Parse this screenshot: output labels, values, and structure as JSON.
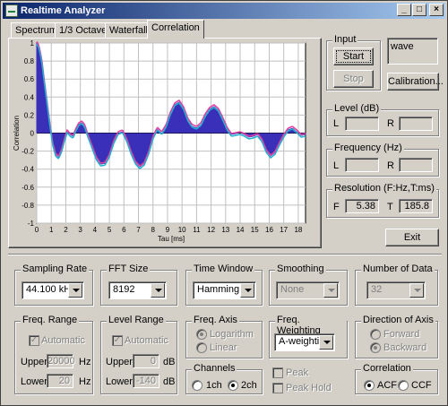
{
  "window": {
    "title": "Realtime Analyzer",
    "btn_min": "_",
    "btn_max": "□",
    "btn_close": "×"
  },
  "tabs": [
    {
      "label": "Spectrum"
    },
    {
      "label": "1/3 Octave"
    },
    {
      "label": "Waterfall"
    },
    {
      "label": "Correlation"
    }
  ],
  "chart_data": {
    "type": "line",
    "ylabel": "Correlation",
    "xlabel": "Tau [ms]",
    "xlim": [
      0,
      18.5
    ],
    "ylim": [
      -1,
      1
    ],
    "x_ticks": [
      "0",
      "1",
      "2",
      "3",
      "4",
      "5",
      "6",
      "7",
      "8",
      "9",
      "10",
      "11",
      "12",
      "13",
      "14",
      "15",
      "16",
      "17",
      "18"
    ],
    "y_ticks": [
      "1",
      "0.8",
      "0.6",
      "0.4",
      "0.2",
      "0",
      "-0.2",
      "-0.4",
      "-0.6",
      "-0.8",
      "-1"
    ],
    "grid": true,
    "fill_color": "#3a2fb8",
    "line_colors": [
      "#e040a0",
      "#20b0d0"
    ],
    "points": [
      [
        0,
        1.0
      ],
      [
        0.1,
        0.98
      ],
      [
        0.2,
        0.92
      ],
      [
        0.35,
        0.8
      ],
      [
        0.5,
        0.6
      ],
      [
        0.7,
        0.35
      ],
      [
        0.9,
        0.1
      ],
      [
        1.1,
        -0.12
      ],
      [
        1.3,
        -0.24
      ],
      [
        1.5,
        -0.27
      ],
      [
        1.7,
        -0.2
      ],
      [
        1.9,
        -0.08
      ],
      [
        2.1,
        0.02
      ],
      [
        2.3,
        -0.02
      ],
      [
        2.5,
        -0.04
      ],
      [
        2.7,
        0.04
      ],
      [
        2.9,
        0.1
      ],
      [
        3.1,
        0.12
      ],
      [
        3.3,
        0.08
      ],
      [
        3.5,
        -0.02
      ],
      [
        3.8,
        -0.15
      ],
      [
        4.1,
        -0.28
      ],
      [
        4.4,
        -0.35
      ],
      [
        4.7,
        -0.34
      ],
      [
        5.0,
        -0.25
      ],
      [
        5.3,
        -0.1
      ],
      [
        5.6,
        0.0
      ],
      [
        5.9,
        0.02
      ],
      [
        6.2,
        -0.08
      ],
      [
        6.5,
        -0.22
      ],
      [
        6.8,
        -0.33
      ],
      [
        7.1,
        -0.38
      ],
      [
        7.4,
        -0.34
      ],
      [
        7.7,
        -0.22
      ],
      [
        8.0,
        -0.05
      ],
      [
        8.3,
        0.05
      ],
      [
        8.6,
        0.0
      ],
      [
        8.9,
        0.08
      ],
      [
        9.2,
        0.22
      ],
      [
        9.5,
        0.32
      ],
      [
        9.8,
        0.35
      ],
      [
        10.1,
        0.28
      ],
      [
        10.4,
        0.15
      ],
      [
        10.7,
        0.08
      ],
      [
        11.0,
        0.06
      ],
      [
        11.3,
        0.1
      ],
      [
        11.6,
        0.2
      ],
      [
        11.9,
        0.27
      ],
      [
        12.2,
        0.3
      ],
      [
        12.5,
        0.26
      ],
      [
        12.8,
        0.16
      ],
      [
        13.1,
        0.05
      ],
      [
        13.4,
        -0.02
      ],
      [
        13.7,
        -0.01
      ],
      [
        14.0,
        0.0
      ],
      [
        14.3,
        -0.02
      ],
      [
        14.6,
        -0.05
      ],
      [
        14.9,
        -0.04
      ],
      [
        15.2,
        -0.02
      ],
      [
        15.5,
        -0.08
      ],
      [
        15.8,
        -0.2
      ],
      [
        16.1,
        -0.26
      ],
      [
        16.4,
        -0.22
      ],
      [
        16.7,
        -0.12
      ],
      [
        17.0,
        -0.03
      ],
      [
        17.3,
        0.04
      ],
      [
        17.6,
        0.06
      ],
      [
        17.9,
        0.02
      ],
      [
        18.2,
        -0.03
      ],
      [
        18.5,
        -0.02
      ]
    ]
  },
  "input_group": {
    "legend": "Input",
    "start": "Start",
    "stop": "Stop"
  },
  "source_label": "wave",
  "calibration_button": "Calibration...",
  "level": {
    "legend": "Level (dB)",
    "l": "L",
    "r": "R",
    "l_value": "",
    "r_value": ""
  },
  "frequency": {
    "legend": "Frequency (Hz)",
    "l": "L",
    "r": "R",
    "l_value": "",
    "r_value": ""
  },
  "resolution": {
    "legend": "Resolution (F:Hz,T:ms)",
    "f": "F",
    "t": "T",
    "f_value": "5.38",
    "t_value": "185.8"
  },
  "exit_button": "Exit",
  "sampling_rate": {
    "legend": "Sampling Rate",
    "value": "44.100 kHz"
  },
  "fft_size": {
    "legend": "FFT Size",
    "value": "8192"
  },
  "time_window": {
    "legend": "Time Window",
    "value": "Hamming"
  },
  "smoothing": {
    "legend": "Smoothing",
    "value": "None"
  },
  "number_of_data": {
    "legend": "Number of Data",
    "value": "32"
  },
  "freq_range": {
    "legend": "Freq. Range",
    "automatic": "Automatic",
    "upper_label": "Upper",
    "upper_value": "20000",
    "upper_unit": "Hz",
    "lower_label": "Lower",
    "lower_value": "20",
    "lower_unit": "Hz"
  },
  "level_range": {
    "legend": "Level Range",
    "automatic": "Automatic",
    "upper_label": "Upper",
    "upper_value": "0",
    "upper_unit": "dB",
    "lower_label": "Lower",
    "lower_value": "-140",
    "lower_unit": "dB"
  },
  "freq_axis": {
    "legend": "Freq. Axis",
    "logarithm": "Logarithm",
    "linear": "Linear"
  },
  "channels": {
    "legend": "Channels",
    "ch1": "1ch",
    "ch2": "2ch"
  },
  "freq_weighting": {
    "legend": "Freq. Weighting",
    "value": "A-weighting"
  },
  "peak": {
    "peak": "Peak",
    "peak_hold": "Peak Hold"
  },
  "direction_of_axis": {
    "legend": "Direction of Axis",
    "forward": "Forward",
    "backward": "Backward"
  },
  "correlation": {
    "legend": "Correlation",
    "acf": "ACF",
    "ccf": "CCF"
  }
}
